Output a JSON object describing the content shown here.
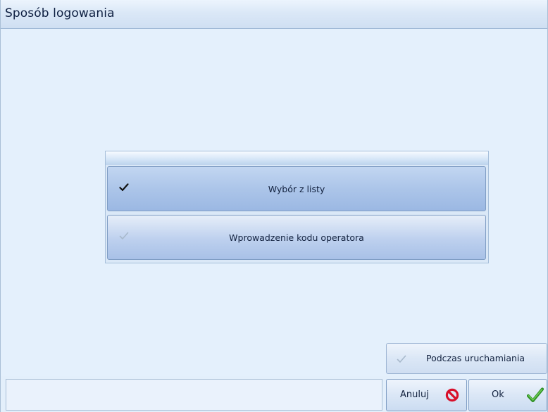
{
  "window": {
    "title": "Sposób logowania"
  },
  "options": [
    {
      "label": "Wybór z listy",
      "checked": true
    },
    {
      "label": "Wprowadzenie kodu operatora",
      "checked": false
    }
  ],
  "startup_button": {
    "label": "Podczas uruchamiania",
    "checked": false
  },
  "footer": {
    "cancel_label": "Anuluj",
    "ok_label": "Ok"
  },
  "colors": {
    "check_dark": "#111111",
    "check_faint": "#a8b9cc",
    "cancel_icon": "#d8102a",
    "ok_icon": "#3aa12e"
  },
  "icons": {
    "option_check": "check-icon",
    "cancel": "no-entry-icon",
    "ok": "green-checkmark-icon"
  }
}
